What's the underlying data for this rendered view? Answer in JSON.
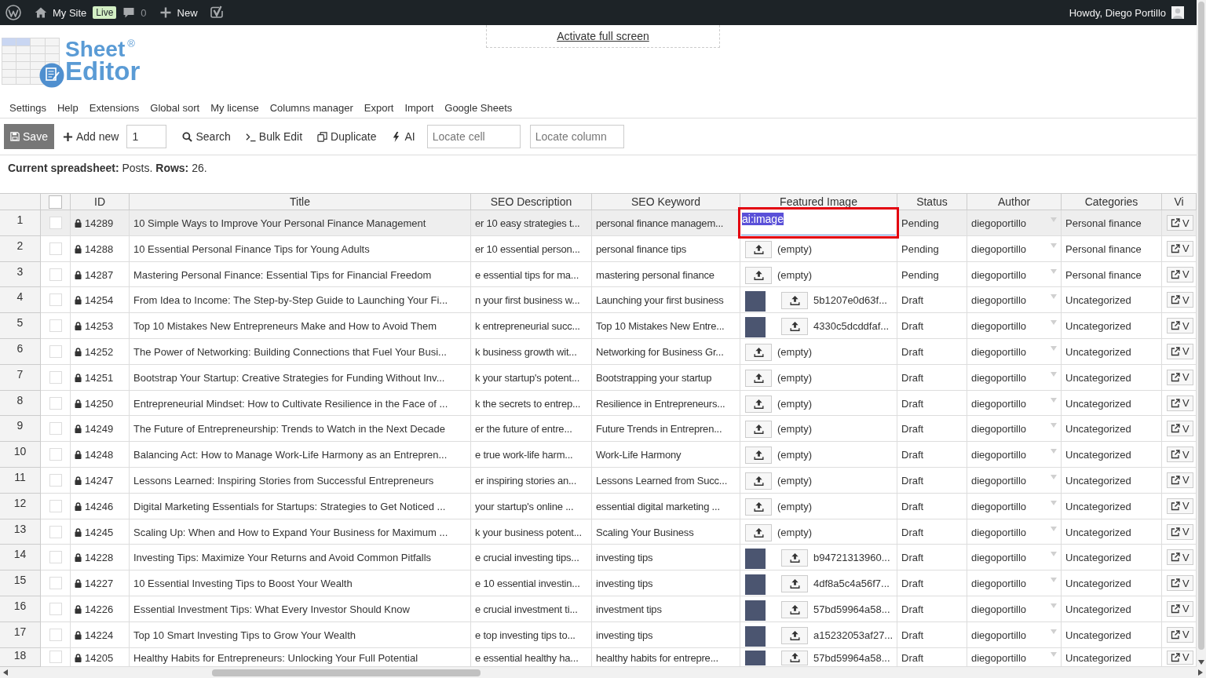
{
  "admin_bar": {
    "site_name": "My Site",
    "live_badge": "Live",
    "comments_count": "0",
    "new_label": "New",
    "greeting": "Howdy, Diego Portillo"
  },
  "logo": {
    "word_1": "Sheet",
    "registered_mark": "®",
    "word_2": "Editor"
  },
  "fullscreen_link": "Activate full screen",
  "menu": [
    "Settings",
    "Help",
    "Extensions",
    "Global sort",
    "My license",
    "Columns manager",
    "Export",
    "Import",
    "Google Sheets"
  ],
  "toolbar": {
    "save": "Save",
    "add_new": "Add new",
    "add_count": "1",
    "search": "Search",
    "bulk_edit": "Bulk Edit",
    "duplicate": "Duplicate",
    "ai": "AI",
    "locate_cell": {
      "placeholder": "Locate cell"
    },
    "locate_column": {
      "placeholder": "Locate column"
    }
  },
  "summary": "**Current spreadsheet:** Posts. **Rows:** 26.",
  "table": {
    "columns": [
      "ID",
      "Title",
      "SEO Description",
      "SEO Keyword",
      "Featured Image",
      "Status",
      "Author",
      "Categories",
      "Vi"
    ],
    "select_all_checked": false,
    "rows": [
      {
        "number": "1",
        "selected": true,
        "checked": false,
        "id": "14289",
        "title": "10 Simple Ways to Improve Your Personal Finance Management",
        "seo_description": "er 10 easy strategies t...",
        "seo_keyword": "personal finance managem...",
        "featured_image": {
          "kind": "editor",
          "value": "ai:image"
        },
        "status": "Pending",
        "author": "diegoportillo",
        "categories": "Personal finance",
        "view_button": "V"
      },
      {
        "number": "2",
        "selected": false,
        "checked": false,
        "id": "14288",
        "title": "10 Essential Personal Finance Tips for Young Adults",
        "seo_description": "er 10 essential person...",
        "seo_keyword": "personal finance tips",
        "featured_image": {
          "kind": "empty",
          "value": "(empty)"
        },
        "status": "Pending",
        "author": "diegoportillo",
        "categories": "Personal finance",
        "view_button": "V"
      },
      {
        "number": "3",
        "selected": false,
        "checked": false,
        "id": "14287",
        "title": "Mastering Personal Finance: Essential Tips for Financial Freedom",
        "seo_description": "e essential tips for ma...",
        "seo_keyword": "mastering personal finance",
        "featured_image": {
          "kind": "empty",
          "value": "(empty)"
        },
        "status": "Pending",
        "author": "diegoportillo",
        "categories": "Personal finance",
        "view_button": "V"
      },
      {
        "number": "4",
        "selected": false,
        "checked": false,
        "id": "14254",
        "title": "From Idea to Income: The Step-by-Step Guide to Launching Your Fi...",
        "seo_description": "n your first business w...",
        "seo_keyword": "Launching your first business",
        "featured_image": {
          "kind": "image",
          "value": "5b1207e0d63f..."
        },
        "status": "Draft",
        "author": "diegoportillo",
        "categories": "Uncategorized",
        "view_button": "V"
      },
      {
        "number": "5",
        "selected": false,
        "checked": false,
        "id": "14253",
        "title": "Top 10 Mistakes New Entrepreneurs Make and How to Avoid Them",
        "seo_description": "k entrepreneurial succ...",
        "seo_keyword": "Top 10 Mistakes New Entre...",
        "featured_image": {
          "kind": "image",
          "value": "4330c5dcddfaf..."
        },
        "status": "Draft",
        "author": "diegoportillo",
        "categories": "Uncategorized",
        "view_button": "V"
      },
      {
        "number": "6",
        "selected": false,
        "checked": false,
        "id": "14252",
        "title": "The Power of Networking: Building Connections that Fuel Your Busi...",
        "seo_description": "k business growth wit...",
        "seo_keyword": "Networking for Business Gr...",
        "featured_image": {
          "kind": "empty",
          "value": "(empty)"
        },
        "status": "Draft",
        "author": "diegoportillo",
        "categories": "Uncategorized",
        "view_button": "V"
      },
      {
        "number": "7",
        "selected": false,
        "checked": false,
        "id": "14251",
        "title": "Bootstrap Your Startup: Creative Strategies for Funding Without Inv...",
        "seo_description": "k your startup's potent...",
        "seo_keyword": "Bootstrapping your startup",
        "featured_image": {
          "kind": "empty",
          "value": "(empty)"
        },
        "status": "Draft",
        "author": "diegoportillo",
        "categories": "Uncategorized",
        "view_button": "V"
      },
      {
        "number": "8",
        "selected": false,
        "checked": false,
        "id": "14250",
        "title": "Entrepreneurial Mindset: How to Cultivate Resilience in the Face of ...",
        "seo_description": "k the secrets to entrep...",
        "seo_keyword": "Resilience in Entrepreneurs...",
        "featured_image": {
          "kind": "empty",
          "value": "(empty)"
        },
        "status": "Draft",
        "author": "diegoportillo",
        "categories": "Uncategorized",
        "view_button": "V"
      },
      {
        "number": "9",
        "selected": false,
        "checked": false,
        "id": "14249",
        "title": "The Future of Entrepreneurship: Trends to Watch in the Next Decade",
        "seo_description": "er the future of entre...",
        "seo_keyword": "Future Trends in Entrepren...",
        "featured_image": {
          "kind": "empty",
          "value": "(empty)"
        },
        "status": "Draft",
        "author": "diegoportillo",
        "categories": "Uncategorized",
        "view_button": "V"
      },
      {
        "number": "10",
        "selected": false,
        "checked": false,
        "id": "14248",
        "title": "Balancing Act: How to Manage Work-Life Harmony as an Entrepren...",
        "seo_description": "e true work-life harm...",
        "seo_keyword": "Work-Life Harmony",
        "featured_image": {
          "kind": "empty",
          "value": "(empty)"
        },
        "status": "Draft",
        "author": "diegoportillo",
        "categories": "Uncategorized",
        "view_button": "V"
      },
      {
        "number": "11",
        "selected": false,
        "checked": false,
        "id": "14247",
        "title": "Lessons Learned: Inspiring Stories from Successful Entrepreneurs",
        "seo_description": "er inspiring stories an...",
        "seo_keyword": "Lessons Learned from Succ...",
        "featured_image": {
          "kind": "empty",
          "value": "(empty)"
        },
        "status": "Draft",
        "author": "diegoportillo",
        "categories": "Uncategorized",
        "view_button": "V"
      },
      {
        "number": "12",
        "selected": false,
        "checked": false,
        "id": "14246",
        "title": "Digital Marketing Essentials for Startups: Strategies to Get Noticed ...",
        "seo_description": "your startup's online ...",
        "seo_keyword": "essential digital marketing ...",
        "featured_image": {
          "kind": "empty",
          "value": "(empty)"
        },
        "status": "Draft",
        "author": "diegoportillo",
        "categories": "Uncategorized",
        "view_button": "V"
      },
      {
        "number": "13",
        "selected": false,
        "checked": false,
        "id": "14245",
        "title": "Scaling Up: When and How to Expand Your Business for Maximum ...",
        "seo_description": "k your business potent...",
        "seo_keyword": "Scaling Your Business",
        "featured_image": {
          "kind": "empty",
          "value": "(empty)"
        },
        "status": "Draft",
        "author": "diegoportillo",
        "categories": "Uncategorized",
        "view_button": "V"
      },
      {
        "number": "14",
        "selected": false,
        "checked": false,
        "id": "14228",
        "title": "Investing Tips: Maximize Your Returns and Avoid Common Pitfalls",
        "seo_description": "e crucial investing tips...",
        "seo_keyword": "investing tips",
        "featured_image": {
          "kind": "image",
          "value": "b94721313960..."
        },
        "status": "Draft",
        "author": "diegoportillo",
        "categories": "Uncategorized",
        "view_button": "V"
      },
      {
        "number": "15",
        "selected": false,
        "checked": false,
        "id": "14227",
        "title": "10 Essential Investing Tips to Boost Your Wealth",
        "seo_description": "e 10 essential investin...",
        "seo_keyword": "investing tips",
        "featured_image": {
          "kind": "image",
          "value": "4df8a5c4a56f7..."
        },
        "status": "Draft",
        "author": "diegoportillo",
        "categories": "Uncategorized",
        "view_button": "V"
      },
      {
        "number": "16",
        "selected": false,
        "checked": false,
        "id": "14226",
        "title": "Essential Investment Tips: What Every Investor Should Know",
        "seo_description": "e crucial investment ti...",
        "seo_keyword": "investment tips",
        "featured_image": {
          "kind": "image",
          "value": "57bd59964a58..."
        },
        "status": "Draft",
        "author": "diegoportillo",
        "categories": "Uncategorized",
        "view_button": "V"
      },
      {
        "number": "17",
        "selected": false,
        "checked": false,
        "id": "14224",
        "title": "Top 10 Smart Investing Tips to Grow Your Wealth",
        "seo_description": "e top investing tips to...",
        "seo_keyword": "investing tips",
        "featured_image": {
          "kind": "image",
          "value": "a15232053af27..."
        },
        "status": "Draft",
        "author": "diegoportillo",
        "categories": "Uncategorized",
        "view_button": "V"
      },
      {
        "number": "18",
        "selected": false,
        "checked": false,
        "id": "14205",
        "title": "Healthy Habits for Entrepreneurs: Unlocking Your Full Potential",
        "seo_description": "e essential healthy ha...",
        "seo_keyword": "healthy habits for entrepre...",
        "featured_image": {
          "kind": "image",
          "value": "57bd59964a58..."
        },
        "status": "Draft",
        "author": "diegoportillo",
        "categories": "Uncategorized",
        "view_button": "V"
      }
    ]
  }
}
